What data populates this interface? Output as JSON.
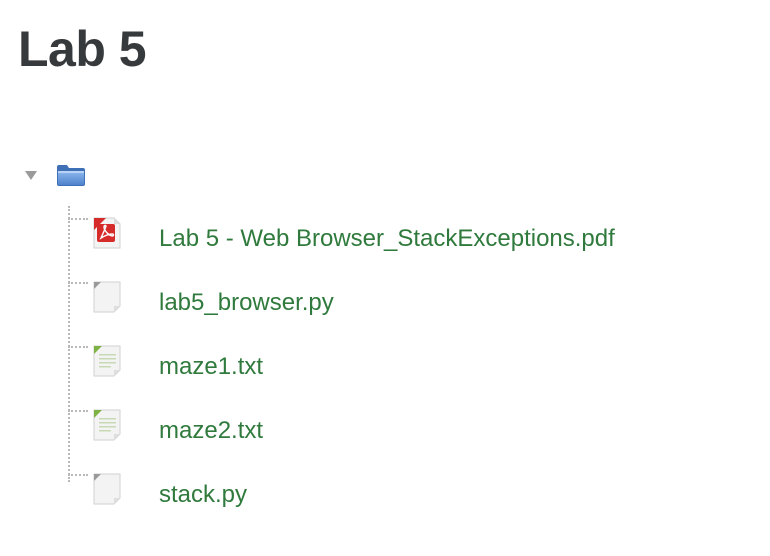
{
  "page": {
    "title": "Lab 5"
  },
  "tree": {
    "expanded": true,
    "folder_icon": "folder-icon",
    "toggle_icon": "triangle-down-icon",
    "files": [
      {
        "name": "Lab 5 - Web Browser_StackExceptions.pdf",
        "icon": "pdf-file-icon"
      },
      {
        "name": "lab5_browser.py",
        "icon": "generic-file-icon"
      },
      {
        "name": "maze1.txt",
        "icon": "text-file-icon"
      },
      {
        "name": "maze2.txt",
        "icon": "text-file-icon"
      },
      {
        "name": "stack.py",
        "icon": "generic-file-icon"
      }
    ]
  },
  "colors": {
    "title": "#373a3c",
    "link": "#2f7a3c",
    "folder": "#5b8fd6",
    "pdf": "#d62b2b",
    "text_file_accent": "#7cb342",
    "tree_line": "#b9b9b9"
  }
}
